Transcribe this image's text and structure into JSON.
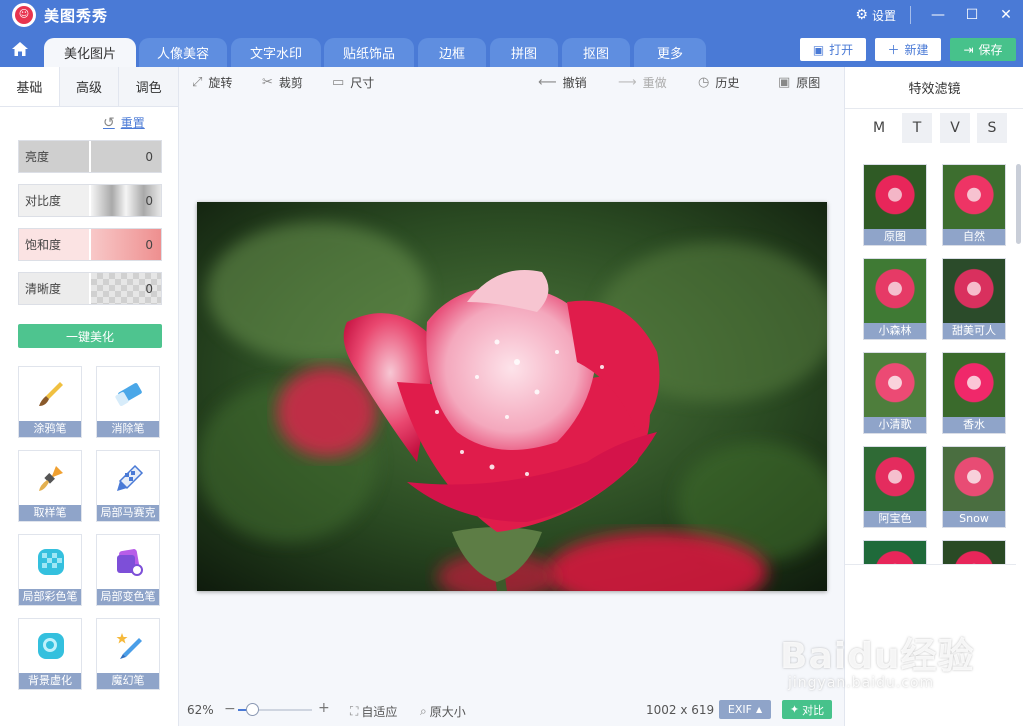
{
  "titlebar": {
    "app_title": "美图秀秀",
    "settings_label": "设置",
    "logo_text": "meitu"
  },
  "nav": {
    "tabs": [
      {
        "label": "美化图片",
        "active": true
      },
      {
        "label": "人像美容",
        "active": false
      },
      {
        "label": "文字水印",
        "active": false
      },
      {
        "label": "贴纸饰品",
        "active": false
      },
      {
        "label": "边框",
        "active": false
      },
      {
        "label": "拼图",
        "active": false
      },
      {
        "label": "抠图",
        "active": false
      },
      {
        "label": "更多",
        "active": false
      }
    ],
    "open_label": "打开",
    "new_label": "新建",
    "save_label": "保存"
  },
  "left": {
    "subtabs": [
      "基础",
      "高级",
      "调色"
    ],
    "reset_label": "重置",
    "sliders": [
      {
        "label": "亮度",
        "value": "0"
      },
      {
        "label": "对比度",
        "value": "0"
      },
      {
        "label": "饱和度",
        "value": "0"
      },
      {
        "label": "清晰度",
        "value": "0"
      }
    ],
    "oneclick_label": "一键美化",
    "tools": [
      "涂鸦笔",
      "消除笔",
      "取样笔",
      "局部马赛克",
      "局部彩色笔",
      "局部变色笔",
      "背景虚化",
      "魔幻笔"
    ]
  },
  "toolbar": {
    "rotate": "旋转",
    "crop": "裁剪",
    "size": "尺寸",
    "undo": "撤销",
    "redo": "重做",
    "history": "历史",
    "original": "原图"
  },
  "status": {
    "zoom": "62%",
    "fit_label": "自适应",
    "original_size_label": "原大小",
    "dimensions": "1002 x 619",
    "exif_label": "EXIF",
    "compare_label": "对比"
  },
  "right": {
    "title": "特效滤镜",
    "letters": [
      "M",
      "T",
      "V",
      "S"
    ],
    "filters": [
      "原图",
      "自然",
      "小森林",
      "甜美可人",
      "小清歌",
      "香水",
      "阿宝色",
      "Snow"
    ]
  },
  "watermark": {
    "main": "Baidu经验",
    "sub": "jingyan.baidu.com"
  },
  "colors": {
    "accent": "#4a7ad6",
    "green": "#47c28b",
    "label_bg": "#8fa4c9"
  }
}
